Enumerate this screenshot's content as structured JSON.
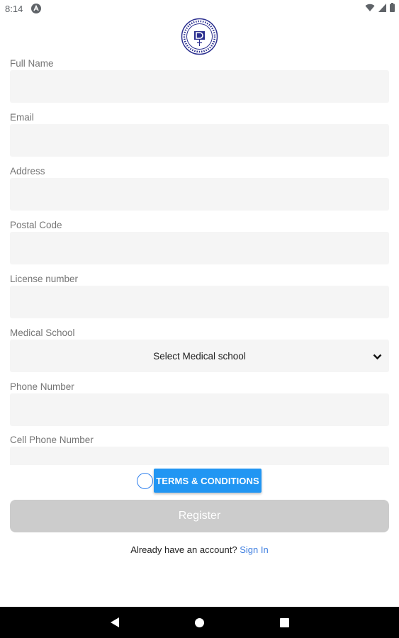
{
  "status_bar": {
    "time": "8:14",
    "icons": [
      "wifi-icon",
      "signal-icon",
      "battery-icon"
    ]
  },
  "logo": {
    "icon": "medical-seal-logo"
  },
  "form": {
    "fields": [
      {
        "label": "Full Name",
        "value": ""
      },
      {
        "label": "Email",
        "value": ""
      },
      {
        "label": "Address",
        "value": ""
      },
      {
        "label": "Postal Code",
        "value": ""
      },
      {
        "label": "License number",
        "value": ""
      },
      {
        "label": "Medical School",
        "value": "Select Medical school"
      },
      {
        "label": "Phone Number",
        "value": ""
      },
      {
        "label": "Cell Phone Number",
        "value": ""
      }
    ]
  },
  "terms": {
    "label": "TERMS & CONDITIONS",
    "checked": false
  },
  "register": {
    "label": "Register",
    "enabled": false
  },
  "signin": {
    "prompt": "Already have an account?",
    "link": "Sign In"
  },
  "colors": {
    "accent": "#2196f3",
    "link": "#3f7fe0",
    "field_bg": "#f5f5f5",
    "button_disabled": "#cccccc"
  }
}
